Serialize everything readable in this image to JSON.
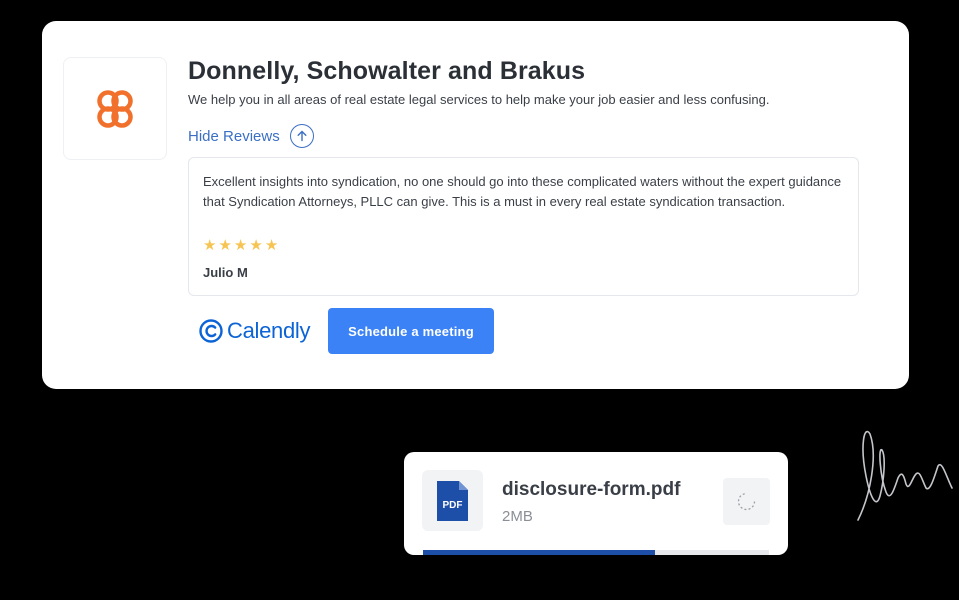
{
  "company": {
    "name": "Donnelly, Schowalter and Brakus",
    "description": "We help you in all areas of real estate legal services to help make your job easier and less confusing.",
    "logo_icon": "flower-logo-icon",
    "brand_color": "#f0702c"
  },
  "reviews_toggle": {
    "label": "Hide Reviews",
    "icon": "arrow-up-icon"
  },
  "review": {
    "text": "Excellent insights into syndication, no one should go into these complicated waters without the expert guidance that Syndication Attorneys, PLLC can give. This is a must in every real estate syndication transaction.",
    "rating": 5,
    "rating_max": 5,
    "reviewer": "Julio M"
  },
  "calendly": {
    "wordmark": "Calendly",
    "icon": "calendly-logo-icon"
  },
  "schedule_button": {
    "label": "Schedule a meeting",
    "color": "#3b82f6"
  },
  "file": {
    "name": "disclosure-form.pdf",
    "size": "2MB",
    "icon_label": "PDF",
    "icon": "pdf-file-icon",
    "status_icon": "loading-spinner-icon",
    "upload_progress": 0.67
  },
  "signature_icon": "signature-icon"
}
